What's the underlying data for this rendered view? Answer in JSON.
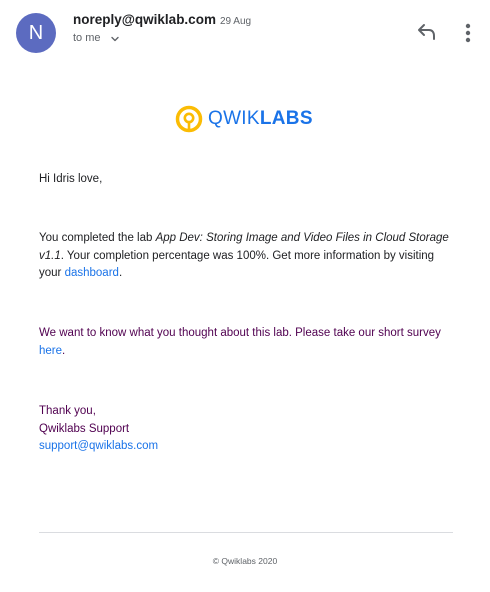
{
  "header": {
    "avatar_letter": "N",
    "sender": "noreply@qwiklab.com",
    "date": "29 Aug",
    "recipient": "to me",
    "reply_icon": "reply-icon",
    "more_icon": "more-vert-icon"
  },
  "logo": {
    "text_light": "QWIK",
    "text_bold": "LABS",
    "colors": {
      "mark": "#fbbc04",
      "text": "#1a73e8"
    }
  },
  "email": {
    "greeting": "Hi Idris love,",
    "completed_prefix": "You completed the lab ",
    "lab_name": "App Dev: Storing Image and Video Files in Cloud Storage v1.1",
    "completed_middle": ". Your completion percentage was 100%. Get more information by visiting your ",
    "dashboard_link": "dashboard",
    "completed_suffix": ".",
    "survey_prefix": "We want to know what you thought about this lab. Please take our short survey ",
    "survey_link": "here",
    "survey_suffix": ".",
    "thanks": "Thank you,",
    "support_name": "Qwiklabs Support",
    "support_email": "support@qwiklabs.com"
  },
  "footer": {
    "copyright": "© Qwiklabs 2020"
  },
  "colors": {
    "avatar": "#5c6bc0",
    "link": "#1a73e8",
    "quoted_text": "#500050"
  }
}
